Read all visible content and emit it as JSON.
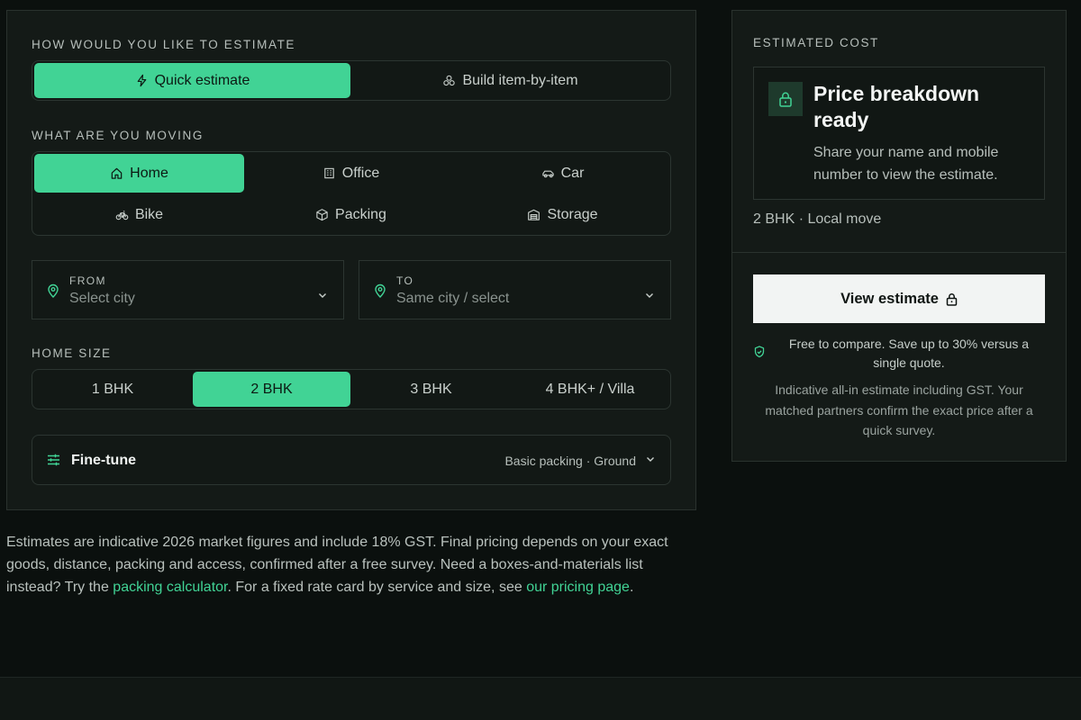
{
  "estimator": {
    "method_label": "HOW WOULD YOU LIKE TO ESTIMATE",
    "methods": [
      {
        "label": "Quick estimate",
        "icon": "lightning-icon",
        "active": true
      },
      {
        "label": "Build item-by-item",
        "icon": "boxes-icon",
        "active": false
      }
    ],
    "moving_label": "WHAT ARE YOU MOVING",
    "moving_options": [
      {
        "label": "Home",
        "icon": "home-icon",
        "active": true
      },
      {
        "label": "Office",
        "icon": "building-icon",
        "active": false
      },
      {
        "label": "Car",
        "icon": "car-icon",
        "active": false
      },
      {
        "label": "Bike",
        "icon": "bike-icon",
        "active": false
      },
      {
        "label": "Packing",
        "icon": "package-icon",
        "active": false
      },
      {
        "label": "Storage",
        "icon": "warehouse-icon",
        "active": false
      }
    ],
    "from": {
      "label": "FROM",
      "value": "Select city"
    },
    "to": {
      "label": "TO",
      "value": "Same city / select"
    },
    "size_label": "HOME SIZE",
    "sizes": [
      {
        "label": "1 BHK",
        "active": false
      },
      {
        "label": "2 BHK",
        "active": true
      },
      {
        "label": "3 BHK",
        "active": false
      },
      {
        "label": "4 BHK+ / Villa",
        "active": false
      }
    ],
    "finetune": {
      "label": "Fine-tune",
      "summary": "Basic packing · Ground"
    }
  },
  "cost": {
    "label": "ESTIMATED COST",
    "title": "Price breakdown ready",
    "description": "Share your name and mobile number to view the estimate.",
    "summary": "2 BHK · Local move",
    "button": "View estimate",
    "compare": "Free to compare. Save up to 30% versus a single quote.",
    "disclaimer": "Indicative all-in estimate including GST. Your matched partners confirm the exact price after a quick survey."
  },
  "footnote": {
    "part1": "Estimates are indicative 2026 market figures and include 18% GST. Final pricing depends on your exact goods, distance, packing and access, confirmed after a free survey. Need a boxes-and-materials list instead? Try the ",
    "link1": "packing calculator",
    "part2": ". For a fixed rate card by service and size, see ",
    "link2": "our pricing page",
    "part3": "."
  },
  "colors": {
    "accent": "#41d395",
    "panel": "#141a17",
    "background": "#0b100e"
  }
}
